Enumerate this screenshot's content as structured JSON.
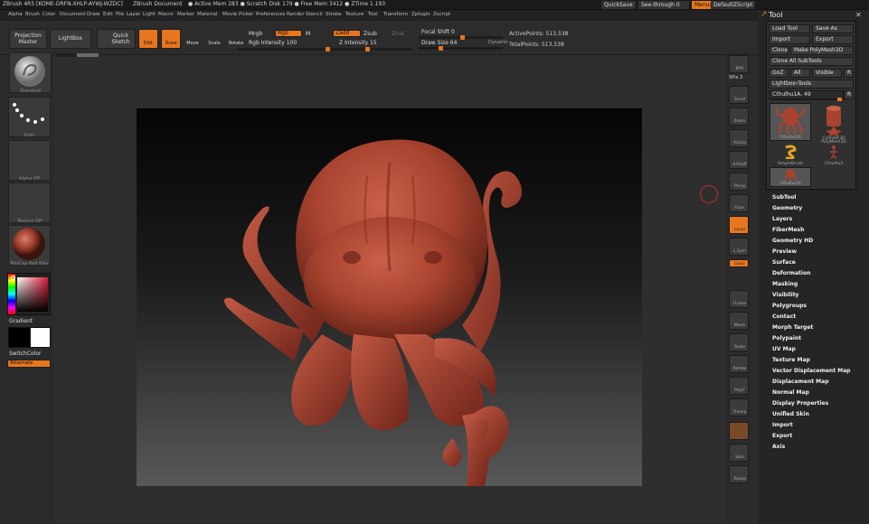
{
  "titlebar": {
    "app": "ZBrush 4R5 [KOME-DRFN-XHLP-AYWJ-WZDC]",
    "document": "ZBrush Document",
    "mem": "● Active Mem 283 ● Scratch Disk 179 ● Free Mem 3412 ● ZTime 1.193",
    "quicksave": "QuickSave",
    "seethrough": "See-through  0",
    "menus": "Menus",
    "defaultscript": "DefaultZScript"
  },
  "menubar": [
    "Alpha",
    "Brush",
    "Color",
    "Document",
    "Draw",
    "Edit",
    "File",
    "Layer",
    "Light",
    "Macro",
    "Marker",
    "Material",
    "Movie",
    "Picker",
    "Preferences",
    "Render",
    "Stencil",
    "Stroke",
    "Texture",
    "Tool",
    "Transform",
    "Zplugin",
    "Zscript"
  ],
  "toolbar": {
    "projection_master": "Projection Master",
    "lightbox": "LightBox",
    "quick_sketch": "Quick Sketch",
    "edit": "Edit",
    "draw": "Draw",
    "move": "Move",
    "scale": "Scale",
    "rotate": "Rotate",
    "mrgb": "Mrgb",
    "rgb": "Rgb",
    "m": "M",
    "rgb_intensity": "Rgb Intensity 100",
    "zadd": "Zadd",
    "zsub": "Zsub",
    "zcut": "Zcut",
    "z_intensity": "Z Intensity 15",
    "focal_shift": "Focal Shift 0",
    "draw_size": "Draw Size 64",
    "dynamic": "Dynamic",
    "active_points": "ActivePoints: 513,538",
    "total_points": "TotalPoints: 513,538"
  },
  "lefttray": {
    "brush": "Standard",
    "stroke": "Dots",
    "alpha": "Alpha Off",
    "texture": "Texture Off",
    "material": "MatCap Red Wax",
    "gradient": "Gradient",
    "switchcolor": "SwitchColor",
    "alternate": "Alternate"
  },
  "rightshelf": [
    "BPR",
    "SPix 3",
    "Scroll",
    "Zoom",
    "Actual",
    "AAHalf",
    "Persp",
    "Floor",
    "Local",
    "L.Sym",
    "Gxyz",
    "Frame",
    "Move",
    "Scale",
    "Rotate",
    "PolyF",
    "Transp",
    "",
    "Solo",
    "Xpose"
  ],
  "toolpanel": {
    "title": "Tool",
    "load_tool": "Load Tool",
    "save_as": "Save As",
    "import": "Import",
    "export": "Export",
    "clone": "Clone",
    "make_polymesh": "Make PolyMesh3D",
    "clone_all_subtools": "Clone All SubTools",
    "goz": "GoZ",
    "all": "All",
    "visible": "Visible",
    "r": "R",
    "lightbox_tools": "Lightbox›Tools",
    "current_tool": "Cthulhu1A. 49",
    "tools": [
      "Cthulhu1A",
      "Cylinder3D",
      "PolyMesh3D",
      "SimpleBrush",
      "Cthulhu2",
      "Cthulhu1A"
    ]
  },
  "toolmenu": [
    "SubTool",
    "Geometry",
    "Layers",
    "FiberMesh",
    "Geometry HD",
    "Preview",
    "Surface",
    "Deformation",
    "Masking",
    "Visibility",
    "Polygroups",
    "Contact",
    "Morph Target",
    "Polypaint",
    "UV Map",
    "Texture Map",
    "Vector Displacement Map",
    "Displacement Map",
    "Normal Map",
    "Display Properties",
    "Unified Skin",
    "Import",
    "Export",
    "Axis"
  ],
  "colors": {
    "accent": "#e8761e",
    "model": "#a8432f",
    "panel": "#303030"
  }
}
